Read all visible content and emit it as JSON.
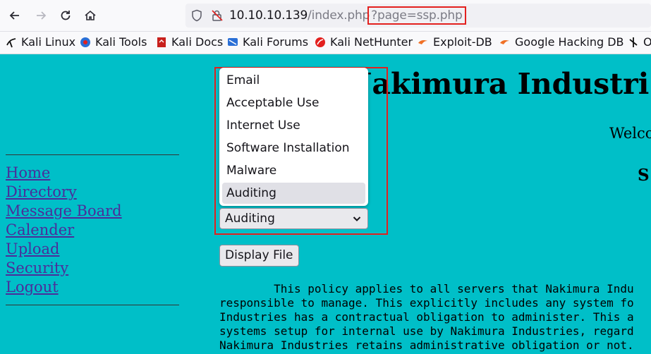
{
  "browser": {
    "url_host": "10.10.10.139",
    "url_path": "/index.php",
    "url_query": "?page=ssp.php"
  },
  "bookmarks": [
    {
      "label": "Kali Linux",
      "icon": "kali-linux-icon"
    },
    {
      "label": "Kali Tools",
      "icon": "kali-tools-icon"
    },
    {
      "label": "Kali Docs",
      "icon": "kali-docs-icon"
    },
    {
      "label": "Kali Forums",
      "icon": "kali-forums-icon"
    },
    {
      "label": "Kali NetHunter",
      "icon": "kali-nethunter-icon"
    },
    {
      "label": "Exploit-DB",
      "icon": "exploit-db-icon"
    },
    {
      "label": "Google Hacking DB",
      "icon": "ghdb-icon"
    },
    {
      "label": "O",
      "icon": "offsec-icon"
    }
  ],
  "sidebar": {
    "links": [
      "Home",
      "Directory",
      "Message Board",
      "Calender",
      "Upload",
      "Security",
      "Logout"
    ]
  },
  "header": {
    "title": "Nakimura Industri",
    "welcome": "Welco",
    "section_heading": "S"
  },
  "policy_form": {
    "options": [
      "Email",
      "Acceptable Use",
      "Internet Use",
      "Software Installation",
      "Malware",
      "Auditing"
    ],
    "selected": "Auditing",
    "button_label": "Display File"
  },
  "policy_text": {
    "lines": [
      "        This policy applies to all servers that Nakimura Indu",
      "responsible to manage. This explicitly includes any system fo",
      "Industries has a contractual obligation to administer. This a",
      "systems setup for internal use by Nakimura Industries, regard",
      "Nakimura Industries retains administrative obligation or not."
    ]
  },
  "colors": {
    "page_background": "#00bfc8",
    "link": "#4b2d9a",
    "highlight": "#e3201e"
  }
}
